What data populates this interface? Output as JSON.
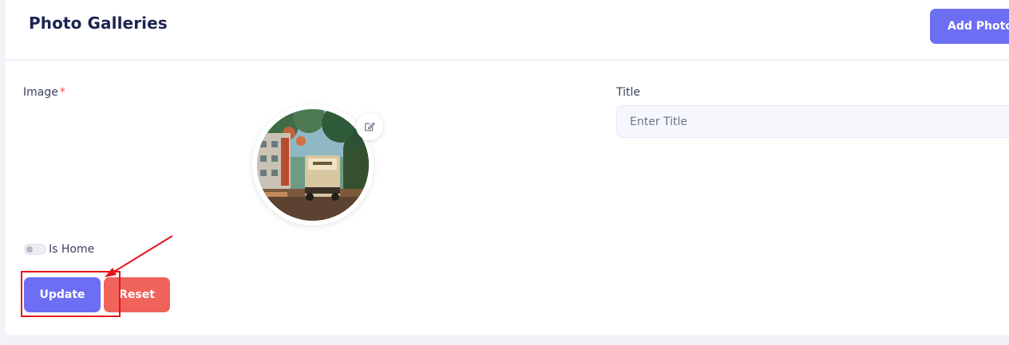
{
  "header": {
    "title": "Photo Galleries",
    "add_button_label": "Add Photo"
  },
  "form": {
    "image_label": "Image",
    "required_mark": "*",
    "title_label": "Title",
    "title_placeholder": "Enter Title",
    "title_value": "",
    "is_home_label": "Is Home",
    "is_home_checked": false,
    "update_label": "Update",
    "reset_label": "Reset"
  },
  "icons": {
    "edit": "edit-icon"
  },
  "colors": {
    "primary": "#6c6ff3",
    "danger": "#f0635a",
    "title": "#1d2451",
    "annotation": "#e8141b"
  }
}
